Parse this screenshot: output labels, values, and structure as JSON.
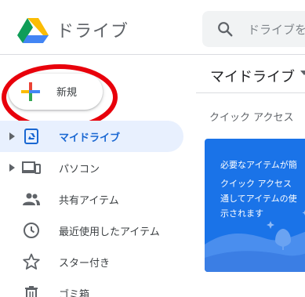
{
  "app": {
    "title": "ドライブ"
  },
  "search": {
    "placeholder": "ドライブを"
  },
  "new_button": {
    "label": "新規"
  },
  "sidebar": {
    "items": [
      {
        "label": "マイドライブ",
        "icon": "my-drive-icon",
        "active": true,
        "expandable": true
      },
      {
        "label": "パソコン",
        "icon": "computers-icon",
        "active": false,
        "expandable": true
      },
      {
        "label": "共有アイテム",
        "icon": "shared-people-icon",
        "active": false,
        "expandable": false
      },
      {
        "label": "最近使用したアイテム",
        "icon": "clock-icon",
        "active": false,
        "expandable": false
      },
      {
        "label": "スター付き",
        "icon": "star-icon",
        "active": false,
        "expandable": false
      },
      {
        "label": "ゴミ箱",
        "icon": "trash-icon",
        "active": false,
        "expandable": false
      }
    ]
  },
  "main": {
    "title": "マイドライブ",
    "quick_access": {
      "label": "クイック アクセス",
      "card": {
        "heading": "必要なアイテムが簡",
        "body_lines": [
          "クイック アクセス",
          "通してアイテムの使",
          "示されます"
        ]
      }
    }
  },
  "colors": {
    "accent_blue": "#1a73e8",
    "active_bg": "#e8f0fe",
    "active_text": "#1967d2",
    "annotation_red": "#e8000b"
  }
}
